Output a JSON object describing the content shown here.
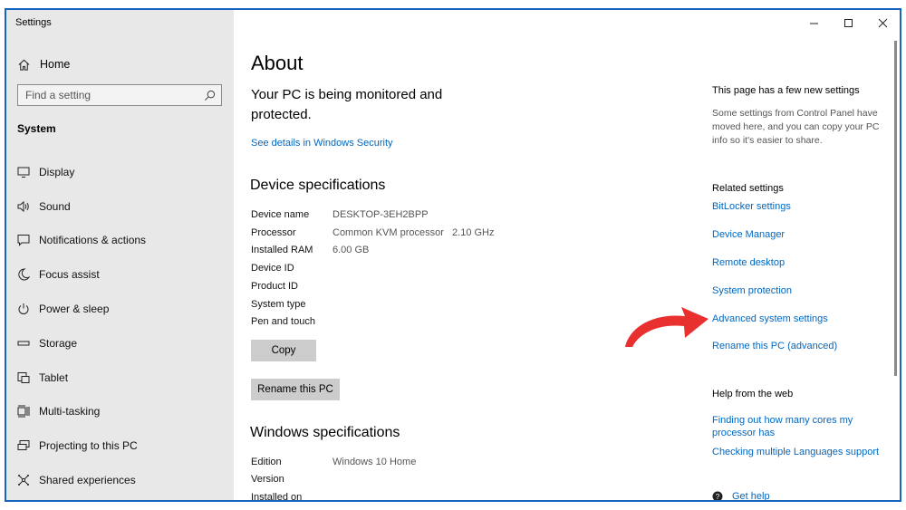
{
  "window": {
    "title": "Settings"
  },
  "sidebar": {
    "home_label": "Home",
    "search_placeholder": "Find a setting",
    "section_label": "System",
    "items": [
      {
        "label": "Display",
        "icon": "display-icon"
      },
      {
        "label": "Sound",
        "icon": "sound-icon"
      },
      {
        "label": "Notifications & actions",
        "icon": "notifications-icon"
      },
      {
        "label": "Focus assist",
        "icon": "moon-icon"
      },
      {
        "label": "Power & sleep",
        "icon": "power-icon"
      },
      {
        "label": "Storage",
        "icon": "storage-icon"
      },
      {
        "label": "Tablet",
        "icon": "tablet-icon"
      },
      {
        "label": "Multi-tasking",
        "icon": "multitasking-icon"
      },
      {
        "label": "Projecting to this PC",
        "icon": "projecting-icon"
      },
      {
        "label": "Shared experiences",
        "icon": "shared-icon"
      }
    ]
  },
  "main": {
    "title": "About",
    "monitor_text": "Your PC is being monitored and protected.",
    "security_link": "See details in Windows Security",
    "device_heading": "Device specifications",
    "device_specs": [
      {
        "key": "Device name",
        "value": "DESKTOP-3EH2BPP"
      },
      {
        "key": "Processor",
        "value": "Common KVM processor   2.10 GHz"
      },
      {
        "key": "Installed RAM",
        "value": "6.00 GB"
      },
      {
        "key": "Device ID",
        "value": ""
      },
      {
        "key": "Product ID",
        "value": ""
      },
      {
        "key": "System type",
        "value": ""
      },
      {
        "key": "Pen and touch",
        "value": ""
      }
    ],
    "copy_button": "Copy",
    "rename_button": "Rename this PC",
    "windows_heading": "Windows specifications",
    "windows_specs": [
      {
        "key": "Edition",
        "value": "Windows 10 Home"
      },
      {
        "key": "Version",
        "value": ""
      },
      {
        "key": "Installed on",
        "value": ""
      }
    ]
  },
  "right_panel": {
    "new_settings_title": "This page has a few new settings",
    "new_settings_desc": "Some settings from Control Panel have moved here, and you can copy your PC info so it's easier to share.",
    "related_title": "Related settings",
    "related_links": [
      "BitLocker settings",
      "Device Manager",
      "Remote desktop",
      "System protection",
      "Advanced system settings",
      "Rename this PC (advanced)"
    ],
    "help_title": "Help from the web",
    "help_links": [
      "Finding out how many cores my processor has",
      "Checking multiple Languages support"
    ],
    "get_help": "Get help"
  },
  "colors": {
    "accent": "#0067c0",
    "sidebar_bg": "#e8e8e8",
    "arrow": "#e8302f",
    "window_border": "#1565c0"
  }
}
